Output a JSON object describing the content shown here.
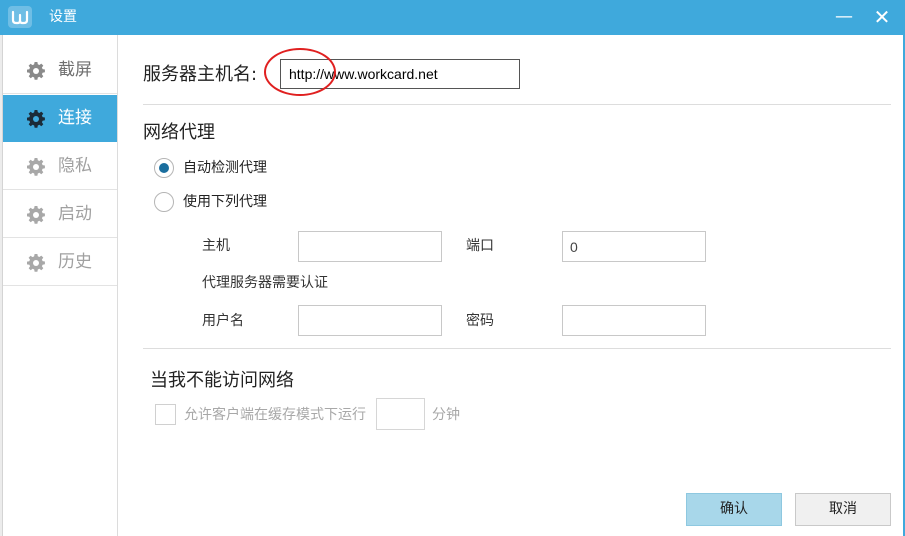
{
  "window": {
    "title": "设置",
    "app_icon": "w-logo-icon",
    "minimize_glyph": "—",
    "close_glyph": "✕",
    "accent_color": "#3fa9dc"
  },
  "sidebar": {
    "items": [
      {
        "label": "截屏",
        "icon": "gear-icon",
        "active": false
      },
      {
        "label": "连接",
        "icon": "gear-icon",
        "active": true
      },
      {
        "label": "隐私",
        "icon": "gear-icon",
        "active": false
      },
      {
        "label": "启动",
        "icon": "gear-icon",
        "active": false
      },
      {
        "label": "历史",
        "icon": "gear-icon",
        "active": false
      }
    ]
  },
  "connection": {
    "server_host_label": "服务器主机名:",
    "server_host_value": "http://www.workcard.net",
    "proxy": {
      "title": "网络代理",
      "auto_detect_label": "自动检测代理",
      "auto_detect_selected": true,
      "manual_label": "使用下列代理",
      "manual_selected": false,
      "host_label": "主机",
      "host_value": "",
      "port_label": "端口",
      "port_value": "0",
      "auth_label": "代理服务器需要认证",
      "username_label": "用户名",
      "username_value": "",
      "password_label": "密码",
      "password_value": ""
    },
    "offline": {
      "title": "当我不能访问网络",
      "cache_mode_label": "允许客户端在缓存模式下运行",
      "cache_mode_checked": false,
      "minutes_value": "",
      "minutes_unit": "分钟"
    }
  },
  "footer": {
    "ok_label": "确认",
    "cancel_label": "取消"
  }
}
